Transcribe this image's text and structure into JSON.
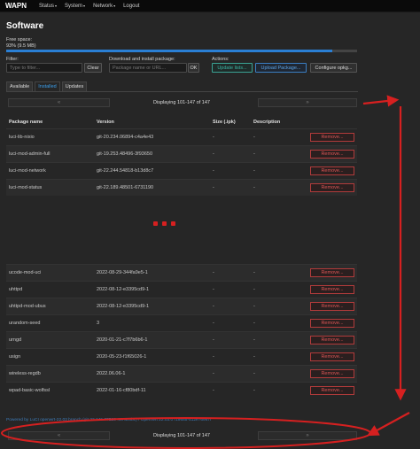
{
  "nav": {
    "brand": "WAPN",
    "items": [
      {
        "label": "Status",
        "caret": "▾"
      },
      {
        "label": "System",
        "caret": "▾"
      },
      {
        "label": "Network",
        "caret": "▾"
      },
      {
        "label": "Logout",
        "caret": ""
      }
    ]
  },
  "page": {
    "title": "Software",
    "free_space_label": "Free space:",
    "free_space_value": "93% (9.5 MB)",
    "free_space_percent": 93
  },
  "filter": {
    "label": "Filter:",
    "placeholder": "Type to filter...",
    "clear_label": "Clear"
  },
  "download": {
    "label": "Download and install package:",
    "placeholder": "Package name or URL...",
    "ok_label": "OK"
  },
  "actions": {
    "label": "Actions:",
    "update": "Update lists...",
    "upload": "Upload Package...",
    "configure": "Configure opkg..."
  },
  "tabs": [
    {
      "label": "Available",
      "active": false
    },
    {
      "label": "Installed",
      "active": true
    },
    {
      "label": "Updates",
      "active": false
    }
  ],
  "pager": {
    "prev": "«",
    "next": "»",
    "text": "Displaying 101-147 of 147"
  },
  "table": {
    "headers": [
      "Package name",
      "Version",
      "Size (.ipk)",
      "Description",
      ""
    ],
    "remove_label": "Remove...",
    "rows_top": [
      {
        "name": "luci-lib-nixio",
        "version": "git-20.234.06894-c4a4e43",
        "size": "-",
        "desc": "-"
      },
      {
        "name": "luci-mod-admin-full",
        "version": "git-19.253.48496-3f93650",
        "size": "-",
        "desc": "-"
      },
      {
        "name": "luci-mod-network",
        "version": "git-22.244.54818-b13d8c7",
        "size": "-",
        "desc": "-"
      },
      {
        "name": "luci-mod-status",
        "version": "git-22.189.48501-6731190",
        "size": "-",
        "desc": "-"
      }
    ],
    "rows_bottom": [
      {
        "name": "ucode-mod-uci",
        "version": "2022-08-29-344fa9e5-1",
        "size": "-",
        "desc": "-"
      },
      {
        "name": "uhttpd",
        "version": "2022-08-12-e3395cd9-1",
        "size": "-",
        "desc": "-"
      },
      {
        "name": "uhttpd-mod-ubus",
        "version": "2022-08-12-e3395cd9-1",
        "size": "-",
        "desc": "-"
      },
      {
        "name": "urandom-seed",
        "version": "3",
        "size": "-",
        "desc": "-"
      },
      {
        "name": "urngd",
        "version": "2020-01-21-c7f7b6b6-1",
        "size": "-",
        "desc": "-"
      },
      {
        "name": "usign",
        "version": "2020-05-23-f1f65026-1",
        "size": "-",
        "desc": "-"
      },
      {
        "name": "wireless-regdb",
        "version": "2022.06.06-1",
        "size": "-",
        "desc": "-"
      },
      {
        "name": "wpad-basic-wolfssl",
        "version": "2022-01-16-cf80bdf-11",
        "size": "-",
        "desc": "-"
      }
    ]
  },
  "footer": "Powered by LuCI openwrt-22.03 branch (git-22.245.77528-467ac8bc) / OpenWrt 22.03.0 r19685-512e76967f",
  "colors": {
    "accent": "#2a7fd4",
    "danger": "#d62020",
    "remove": "#d55555"
  }
}
